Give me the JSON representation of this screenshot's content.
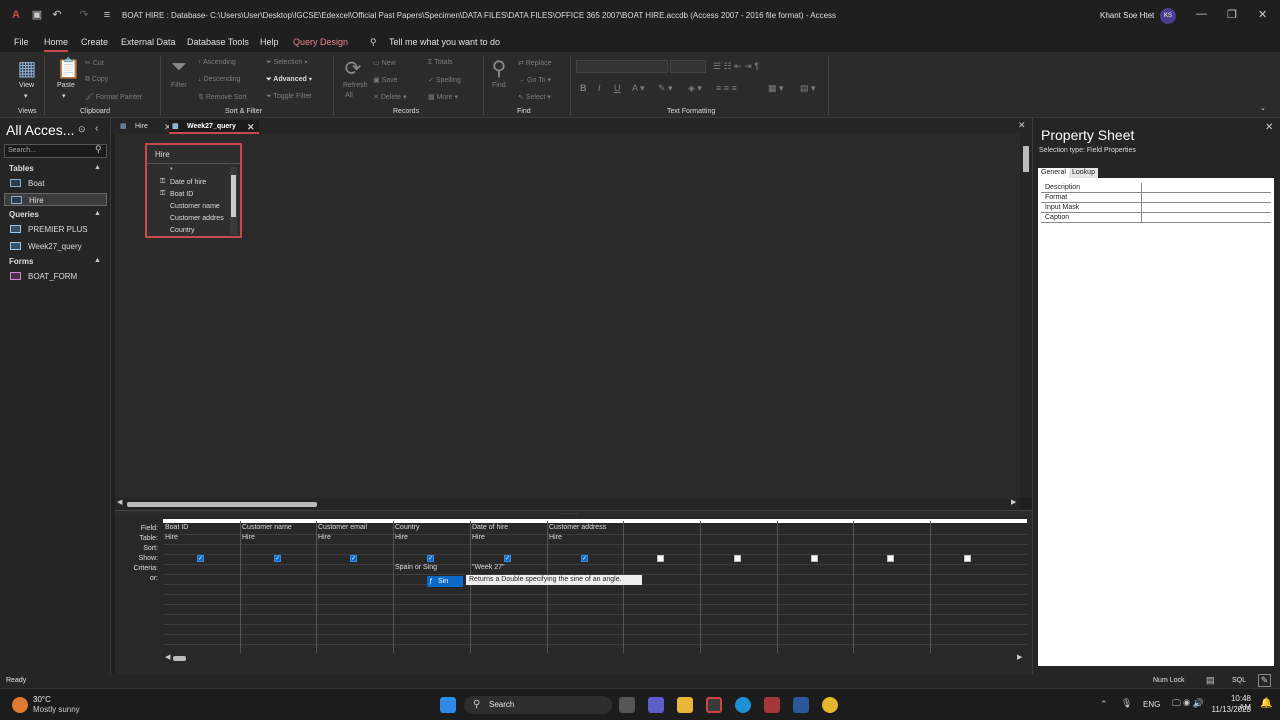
{
  "titlebar": {
    "title": "BOAT HIRE : Database- C:\\Users\\User\\Desktop\\IGCSE\\Edexcel\\Official Past Papers\\Specimen\\DATA FILES\\DATA FILES\\OFFICE 365 2007\\BOAT HIRE.accdb (Access 2007 - 2016 file format)  -  Access",
    "user_name": "Khant Soe Htet",
    "user_initials": "KS"
  },
  "menu": {
    "items": [
      "File",
      "Home",
      "Create",
      "External Data",
      "Database Tools",
      "Help",
      "Query Design"
    ],
    "tell_me": "Tell me what you want to do",
    "active": "Home"
  },
  "ribbon": {
    "views": {
      "label": "Views",
      "view": "View"
    },
    "clipboard": {
      "label": "Clipboard",
      "paste": "Paste",
      "cut": "Cut",
      "copy": "Copy",
      "format_painter": "Format Painter"
    },
    "sort_filter": {
      "label": "Sort & Filter",
      "filter": "Filter",
      "ascending": "Ascending",
      "descending": "Descending",
      "remove_sort": "Remove Sort",
      "selection": "Selection",
      "advanced": "Advanced",
      "toggle_filter": "Toggle Filter"
    },
    "records": {
      "label": "Records",
      "refresh": "Refresh",
      "refresh_sub": "All",
      "new": "New",
      "save": "Save",
      "delete": "Delete",
      "totals": "Totals",
      "spelling": "Spelling",
      "more": "More"
    },
    "find": {
      "label": "Find",
      "find": "Find",
      "replace": "Replace",
      "goto": "Go To",
      "select": "Select"
    },
    "text_formatting": {
      "label": "Text Formatting"
    }
  },
  "nav": {
    "title": "All Acces...",
    "search_placeholder": "Search...",
    "groups": [
      {
        "name": "Tables",
        "items": [
          "Boat",
          "Hire"
        ]
      },
      {
        "name": "Queries",
        "items": [
          "PREMIER PLUS",
          "Week27_query"
        ]
      },
      {
        "name": "Forms",
        "items": [
          "BOAT_FORM"
        ]
      }
    ]
  },
  "tabs": [
    "Hire",
    "Week27_query"
  ],
  "table_box": {
    "title": "Hire",
    "fields": [
      "*",
      "Date of hire",
      "Boat ID",
      "Customer name",
      "Customer addres",
      "Country"
    ]
  },
  "grid": {
    "row_labels": [
      "Field:",
      "Table:",
      "Sort:",
      "Show:",
      "Criteria:",
      "or:"
    ],
    "columns": [
      {
        "field": "Boat ID",
        "table": "Hire",
        "show": true,
        "criteria": ""
      },
      {
        "field": "Customer name",
        "table": "Hire",
        "show": true,
        "criteria": ""
      },
      {
        "field": "Customer email",
        "table": "Hire",
        "show": true,
        "criteria": ""
      },
      {
        "field": "Country",
        "table": "Hire",
        "show": true,
        "criteria": "Spain or Sing"
      },
      {
        "field": "Date of hire",
        "table": "Hire",
        "show": true,
        "criteria": "\"Week 27\""
      },
      {
        "field": "Customer address",
        "table": "Hire",
        "show": true,
        "criteria": ""
      },
      {
        "field": "",
        "table": "",
        "show": false,
        "criteria": ""
      },
      {
        "field": "",
        "table": "",
        "show": false,
        "criteria": ""
      },
      {
        "field": "",
        "table": "",
        "show": false,
        "criteria": ""
      },
      {
        "field": "",
        "table": "",
        "show": false,
        "criteria": ""
      },
      {
        "field": "",
        "table": "",
        "show": false,
        "criteria": ""
      }
    ],
    "autocomplete": "Sin",
    "tooltip": "Returns a Double specifying the sine of an angle."
  },
  "property_sheet": {
    "title": "Property Sheet",
    "selection_type": "Selection type:  Field Properties",
    "tabs": [
      "General",
      "Lookup"
    ],
    "rows": [
      "Description",
      "Format",
      "Input Mask",
      "Caption"
    ]
  },
  "status": {
    "left": "Ready",
    "numlock": "Num Lock",
    "sql": "SQL"
  },
  "taskbar": {
    "weather_temp": "30°C",
    "weather_desc": "Mostly sunny",
    "search": "Search",
    "lang": "ENG",
    "time": "10:48 AM",
    "date": "11/13/2023"
  },
  "colors": {
    "accent": "#c74b4b",
    "check": "#0a68c8"
  }
}
